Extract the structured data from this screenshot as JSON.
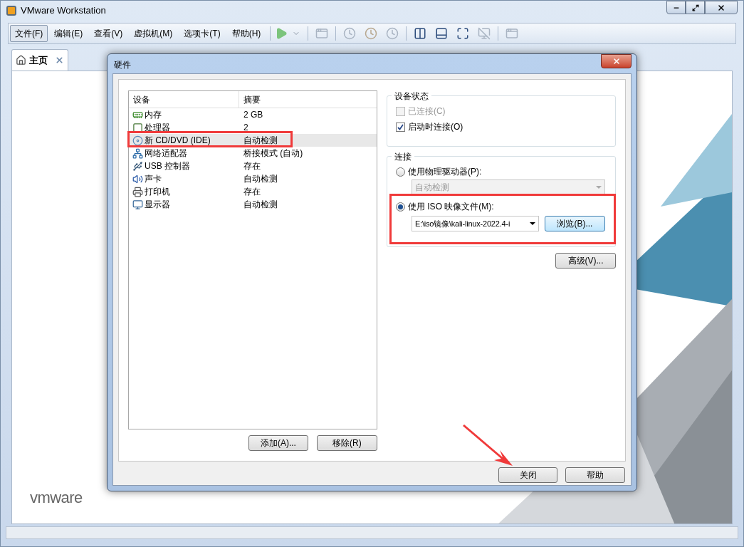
{
  "window": {
    "title": "VMware Workstation"
  },
  "menu": [
    {
      "label": "文件(F)",
      "selected": true
    },
    {
      "label": "编辑(E)",
      "selected": false
    },
    {
      "label": "查看(V)",
      "selected": false
    },
    {
      "label": "虚拟机(M)",
      "selected": false
    },
    {
      "label": "选项卡(T)",
      "selected": false
    },
    {
      "label": "帮助(H)",
      "selected": false
    }
  ],
  "tabs": [
    {
      "label": "主页",
      "selected": true
    }
  ],
  "logo": {
    "text": "vmware"
  },
  "dialog": {
    "title": "硬件",
    "columns": [
      "设备",
      "摘要"
    ],
    "devices": [
      {
        "kind": "memory",
        "name": "内存",
        "summary": "2 GB",
        "selected": false
      },
      {
        "kind": "cpu",
        "name": "处理器",
        "summary": "2",
        "selected": false
      },
      {
        "kind": "cdrom",
        "name": "新 CD/DVD (IDE)",
        "summary": "自动检测",
        "selected": true
      },
      {
        "kind": "network",
        "name": "网络适配器",
        "summary": "桥接模式 (自动)",
        "selected": false
      },
      {
        "kind": "usb",
        "name": "USB 控制器",
        "summary": "存在",
        "selected": false
      },
      {
        "kind": "sound",
        "name": "声卡",
        "summary": "自动检测",
        "selected": false
      },
      {
        "kind": "printer",
        "name": "打印机",
        "summary": "存在",
        "selected": false
      },
      {
        "kind": "display",
        "name": "显示器",
        "summary": "自动检测",
        "selected": false
      }
    ],
    "list_buttons": [
      "添加(A)...",
      "移除(R)"
    ],
    "device_status": {
      "title": "设备状态",
      "checkboxes": [
        {
          "label": "已连接(C)",
          "checked": false,
          "disabled": true
        },
        {
          "label": "启动时连接(O)",
          "checked": true,
          "disabled": false
        }
      ]
    },
    "connection": {
      "title": "连接",
      "physical": {
        "label": "使用物理驱动器(P):",
        "selected": false,
        "drive": "自动检测"
      },
      "iso": {
        "label": "使用 ISO 映像文件(M):",
        "selected": true,
        "path": "E:\\iso镜像\\kali-linux-2022.4-i",
        "browse": "浏览(B)..."
      }
    },
    "advanced_button": "高级(V)...",
    "footer_buttons": [
      "关闭",
      "帮助"
    ]
  }
}
